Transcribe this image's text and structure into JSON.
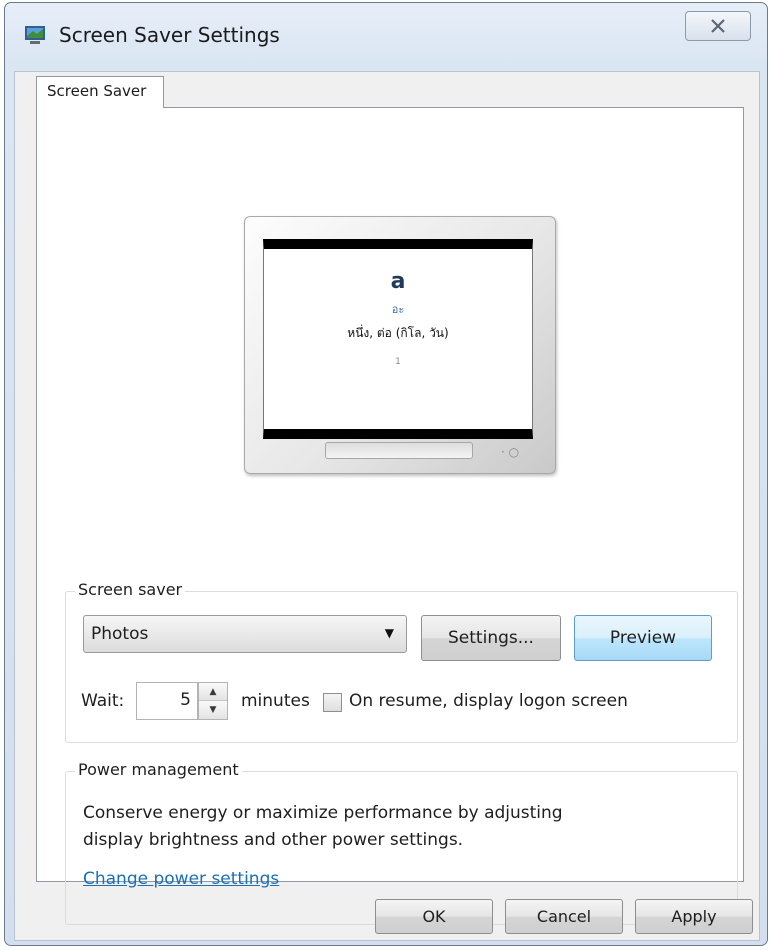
{
  "window": {
    "title": "Screen Saver Settings"
  },
  "tabs": [
    {
      "label": "Screen Saver"
    }
  ],
  "preview": {
    "word": "a",
    "phonetic": "อะ",
    "meaning": "หนึ่ง, ต่อ (กิโล, วัน)",
    "footer": "1"
  },
  "screen_saver": {
    "group_label": "Screen saver",
    "selected": "Photos",
    "settings_label": "Settings...",
    "preview_label": "Preview",
    "wait_label": "Wait:",
    "wait_value": "5",
    "minutes_label": "minutes",
    "resume_label": "On resume, display logon screen",
    "resume_checked": false
  },
  "power": {
    "group_label": "Power management",
    "description_line1": "Conserve energy or maximize performance by adjusting",
    "description_line2": "display brightness and other power settings.",
    "link": "Change power settings"
  },
  "footer": {
    "ok": "OK",
    "cancel": "Cancel",
    "apply": "Apply"
  },
  "colors": {
    "link": "#1b6fb5",
    "title_bar": "#dbe6f3",
    "preview_button": "#bee6fd"
  }
}
